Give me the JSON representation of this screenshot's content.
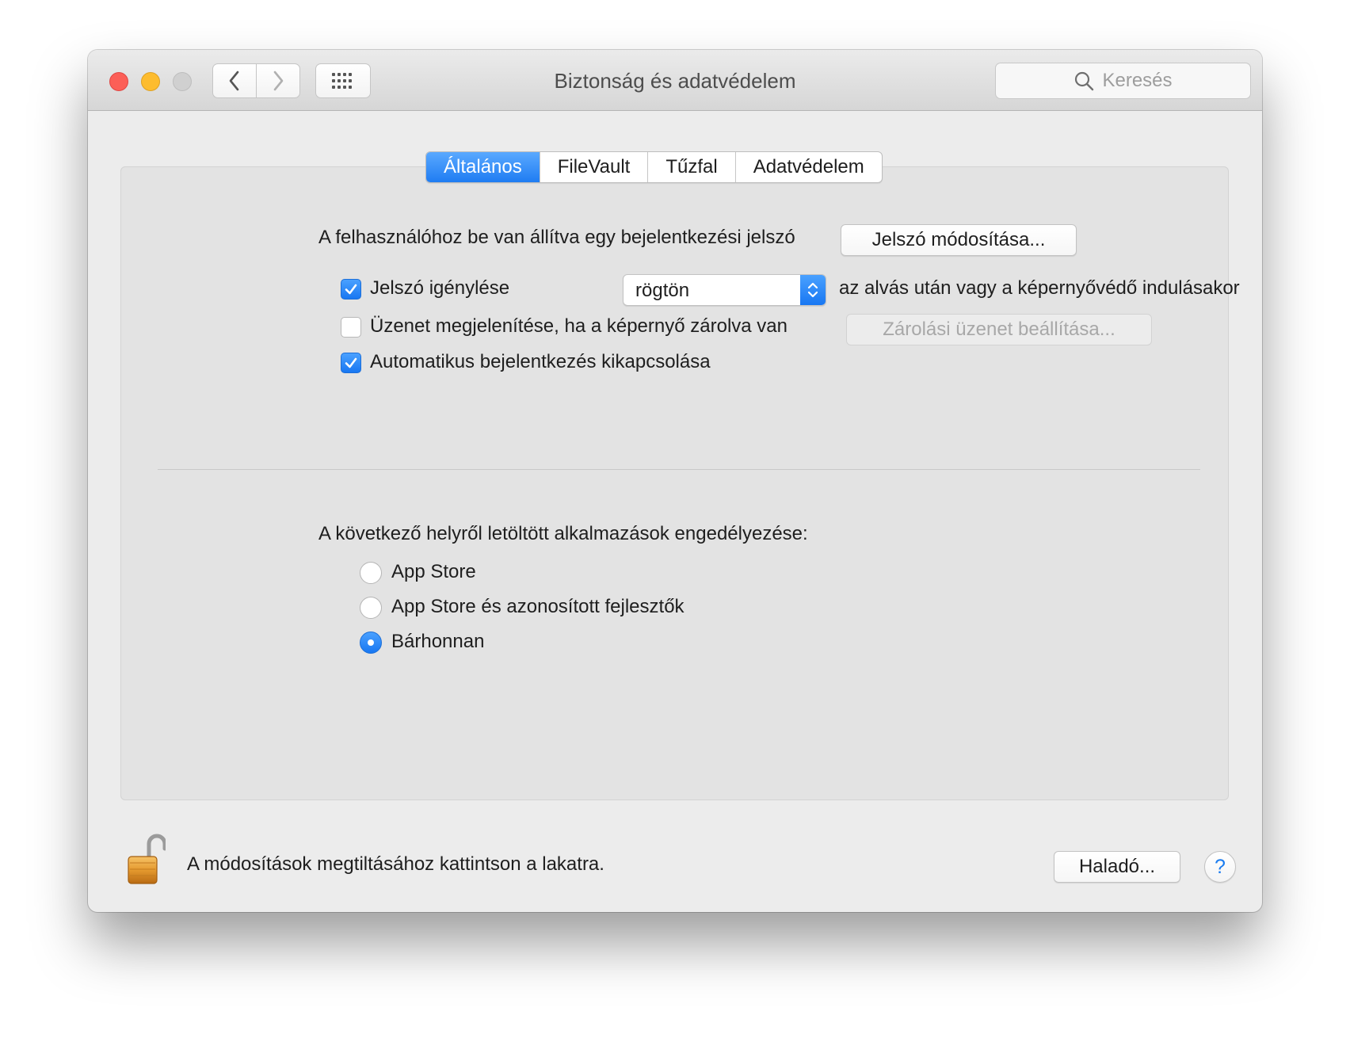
{
  "window": {
    "title": "Biztonság és adatvédelem",
    "search_placeholder": "Keresés"
  },
  "toolbar": {
    "back_icon": "chevron-left-icon",
    "forward_icon": "chevron-right-icon",
    "show_all_icon": "grid-icon"
  },
  "tabs": [
    {
      "label": "Általános",
      "active": true
    },
    {
      "label": "FileVault",
      "active": false
    },
    {
      "label": "Tűzfal",
      "active": false
    },
    {
      "label": "Adatvédelem",
      "active": false
    }
  ],
  "general": {
    "password_set_text": "A felhasználóhoz be van állítva egy bejelentkezési jelszó",
    "change_password_button": "Jelszó módosítása...",
    "require_password": {
      "label": "Jelszó igénylése",
      "checked": true,
      "delay_value": "rögtön",
      "suffix": "az alvás után vagy a képernyővédő indulásakor"
    },
    "show_message": {
      "label": "Üzenet megjelenítése, ha a képernyő zárolva van",
      "checked": false,
      "button": "Zárolási üzenet beállítása..."
    },
    "disable_auto_login": {
      "label": "Automatikus bejelentkezés kikapcsolása",
      "checked": true
    }
  },
  "downloads": {
    "heading": "A következő helyről letöltött alkalmazások engedélyezése:",
    "options": [
      {
        "label": "App Store",
        "selected": false
      },
      {
        "label": "App Store és azonosított fejlesztők",
        "selected": false
      },
      {
        "label": "Bárhonnan",
        "selected": true
      }
    ]
  },
  "footer": {
    "lock_text": "A módosítások megtiltásához kattintson a lakatra.",
    "advanced_button": "Haladó...",
    "help_label": "?"
  },
  "colors": {
    "accent": "#1f7cf2",
    "close": "#fc5f57",
    "minimize": "#fdbc2e",
    "zoom_disabled": "#d0d0d0"
  }
}
